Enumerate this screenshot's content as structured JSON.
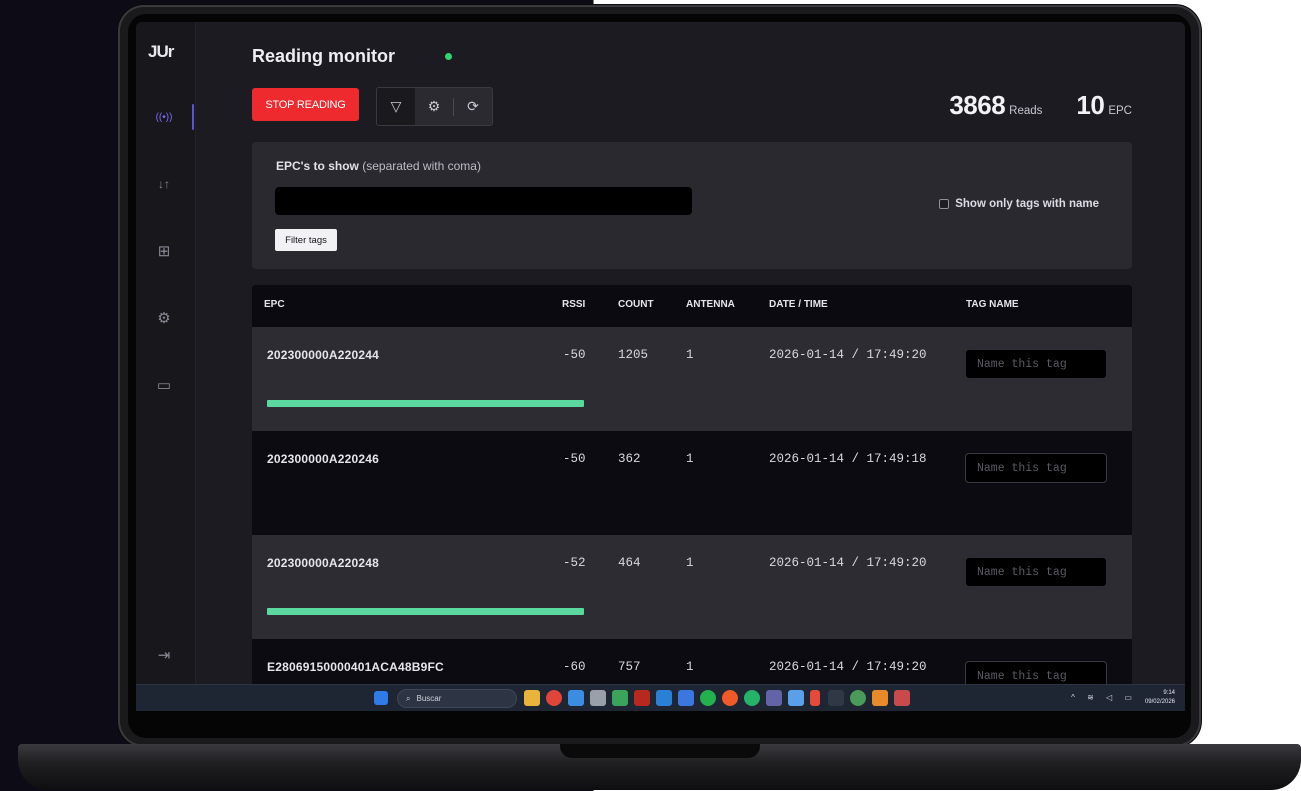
{
  "app": {
    "logo_text": "JUr",
    "title": "Reading monitor",
    "status_color": "#2ed573"
  },
  "sidebar": {
    "items": [
      {
        "icon": "antenna-signal-icon",
        "label": "((•))",
        "active": true
      },
      {
        "icon": "sliders-icon",
        "label": "↓↑"
      },
      {
        "icon": "network-icon",
        "label": "⊞"
      },
      {
        "icon": "gear-icon",
        "label": "⚙"
      },
      {
        "icon": "keyboard-icon",
        "label": "▭"
      },
      {
        "icon": "logout-icon",
        "label": "⇥"
      }
    ]
  },
  "toolbar": {
    "stop_label": "STOP READING",
    "filter_icon": "▽",
    "settings_icon": "⚙",
    "refresh_icon": "⟳"
  },
  "stats": {
    "reads_value": "3868",
    "reads_label": "Reads",
    "epc_value": "10",
    "epc_label": "EPC"
  },
  "filter": {
    "label_bold": "EPC's to show",
    "label_hint": "(separated with coma)",
    "input_value": "",
    "button_label": "Filter tags",
    "checkbox_label": "Show only tags with name",
    "checkbox_checked": false
  },
  "table": {
    "headers": {
      "epc": "EPC",
      "rssi": "RSSI",
      "count": "COUNT",
      "antenna": "ANTENNA",
      "datetime": "DATE / TIME",
      "tag_name": "TAG NAME"
    },
    "name_placeholder": "Name this tag",
    "rows": [
      {
        "epc": "202300000A220244",
        "rssi": "-50",
        "count": "1205",
        "antenna": "1",
        "datetime": "2026-01-14 / 17:49:20",
        "bar_fraction": 1.0,
        "shade": "light"
      },
      {
        "epc": "202300000A220246",
        "rssi": "-50",
        "count": "362",
        "antenna": "1",
        "datetime": "2026-01-14 / 17:49:18",
        "bar_fraction": 0,
        "shade": "dark"
      },
      {
        "epc": "202300000A220248",
        "rssi": "-52",
        "count": "464",
        "antenna": "1",
        "datetime": "2026-01-14 / 17:49:20",
        "bar_fraction": 1.0,
        "shade": "light"
      },
      {
        "epc": "E28069150000401ACA48B9FC",
        "rssi": "-60",
        "count": "757",
        "antenna": "1",
        "datetime": "2026-01-14 / 17:49:20",
        "bar_fraction": 0,
        "shade": "dark"
      }
    ],
    "bar_color": "#5ad8a0"
  },
  "taskbar": {
    "search_label": "Buscar",
    "time": "9:14",
    "date": "09/02/2026"
  },
  "colors": {
    "stop_button": "#ee2a2f",
    "accent": "#7b6cf6",
    "background": "#1c1b21"
  }
}
